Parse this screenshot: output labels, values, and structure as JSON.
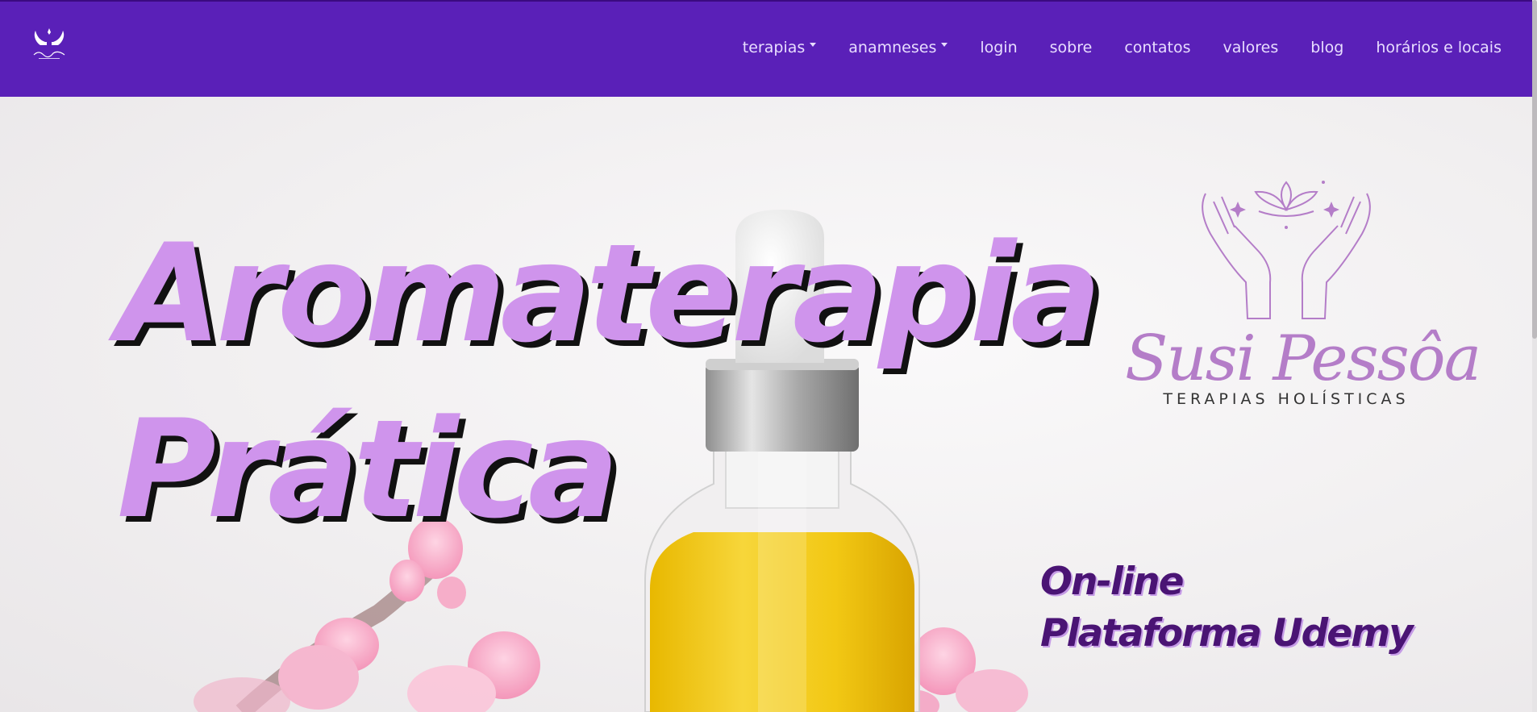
{
  "nav": {
    "logo_icon": "hands-logo-icon",
    "items": [
      {
        "label": "terapias",
        "dropdown": true
      },
      {
        "label": "anamneses",
        "dropdown": true
      },
      {
        "label": "login",
        "dropdown": false
      },
      {
        "label": "sobre",
        "dropdown": false
      },
      {
        "label": "contatos",
        "dropdown": false
      },
      {
        "label": "valores",
        "dropdown": false
      },
      {
        "label": "blog",
        "dropdown": false
      },
      {
        "label": "horários e locais",
        "dropdown": false
      }
    ]
  },
  "hero": {
    "headline_line1": "Aromaterapia",
    "headline_line2": "Prática",
    "subline_line1": "On-line",
    "subline_line2": "Plataforma Udemy",
    "brand_name": "Susi Pessôa",
    "brand_tagline": "TERAPIAS HOLÍSTICAS",
    "image_subject": "essential-oil-bottle-with-pink-flowers"
  },
  "colors": {
    "navbar": "#5a20b8",
    "headline": "#cf94ec",
    "subline": "#4a1474",
    "brand": "#b47dc8"
  }
}
